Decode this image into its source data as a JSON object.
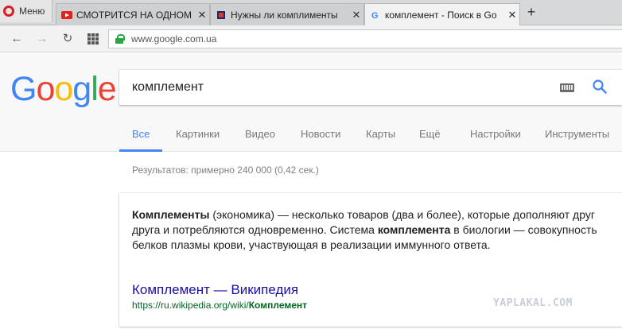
{
  "browser": {
    "menu_label": "Меню",
    "tabs": [
      {
        "title": "СМОТРИТСЯ НА ОДНОМ",
        "active": false,
        "favicon": "youtube-icon"
      },
      {
        "title": "Нужны ли комплименты",
        "active": false,
        "favicon": "yaplakal-icon"
      },
      {
        "title": "комплемент - Поиск в Go",
        "active": true,
        "favicon": "google-g-icon"
      }
    ],
    "new_tab_label": "+",
    "address": "www.google.com.ua"
  },
  "google": {
    "logo": [
      "G",
      "o",
      "o",
      "g",
      "l",
      "e"
    ],
    "logo_colors": [
      "#4285f4",
      "#ea4335",
      "#fbbc05",
      "#4285f4",
      "#34a853",
      "#ea4335"
    ],
    "query": "комплемент",
    "nav": [
      "Все",
      "Картинки",
      "Видео",
      "Новости",
      "Карты",
      "Ещё",
      "Настройки",
      "Инструменты"
    ]
  },
  "results": {
    "stats": "Результатов: примерно 240 000 (0,42 сек.)",
    "snippet": [
      {
        "text": "Комплементы",
        "bold": true
      },
      {
        "text": " (экономика) — несколько товаров (два и более), которые дополняют друг друга и потребляются одновременно. Система ",
        "bold": false
      },
      {
        "text": "комплемента",
        "bold": true
      },
      {
        "text": " в биологии — совокупность белков плазмы крови, участвующая в реализации иммунного ответа.",
        "bold": false
      }
    ],
    "link_title": "Комплемент — Википедия",
    "url_prefix": "https://ru.wikipedia.org/wiki/",
    "url_bold": "Комплемент"
  },
  "watermark": "YAPLAKAL.COM"
}
